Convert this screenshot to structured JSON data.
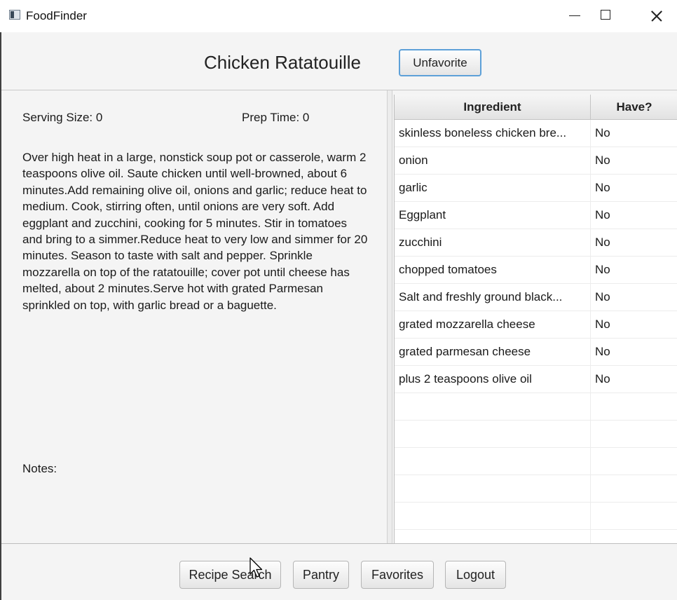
{
  "window": {
    "title": "FoodFinder"
  },
  "recipe": {
    "title": "Chicken Ratatouille",
    "favorite_button": "Unfavorite",
    "serving_size": "Serving Size: 0",
    "prep_time": "Prep Time: 0",
    "instructions": "Over high heat in a large, nonstick soup pot or casserole, warm 2 teaspoons olive oil. Saute chicken until well-browned, about 6 minutes.Add remaining olive oil, onions and garlic; reduce heat to medium. Cook, stirring often, until onions are very soft. Add eggplant and zucchini, cooking for 5 minutes. Stir in tomatoes and bring to a simmer.Reduce heat to very low and simmer for 20 minutes. Season to taste with salt and pepper. Sprinkle mozzarella on top of the ratatouille; cover pot until cheese has melted, about 2 minutes.Serve hot with grated Parmesan sprinkled on top, with garlic bread or a baguette.",
    "notes_label": "Notes:"
  },
  "ingredients": {
    "columns": [
      "Ingredient",
      "Have?"
    ],
    "rows": [
      [
        "skinless boneless chicken bre...",
        "No"
      ],
      [
        "onion",
        "No"
      ],
      [
        "garlic",
        "No"
      ],
      [
        "Eggplant",
        "No"
      ],
      [
        "zucchini",
        "No"
      ],
      [
        "chopped tomatoes",
        "No"
      ],
      [
        "Salt and freshly ground black...",
        "No"
      ],
      [
        "grated mozzarella cheese",
        "No"
      ],
      [
        "grated parmesan cheese",
        "No"
      ],
      [
        "plus 2 teaspoons olive oil",
        "No"
      ],
      [
        "",
        ""
      ],
      [
        "",
        ""
      ],
      [
        "",
        ""
      ],
      [
        "",
        ""
      ],
      [
        "",
        ""
      ]
    ]
  },
  "nav": {
    "recipe_search": "Recipe Search",
    "pantry": "Pantry",
    "favorites": "Favorites",
    "logout": "Logout"
  },
  "icons": {
    "app": "app-window-icon",
    "minimize": "minimize-icon",
    "maximize": "maximize-icon",
    "close": "close-icon",
    "cursor": "mouse-pointer-icon"
  },
  "colors": {
    "focus_border": "#5da0d8",
    "background": "#f4f4f4"
  }
}
